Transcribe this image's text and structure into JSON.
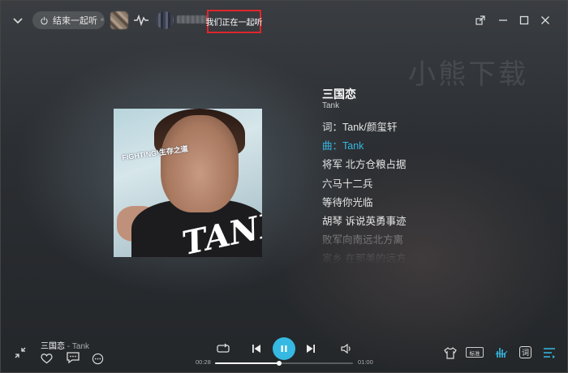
{
  "topbar": {
    "end_together_label": "结束一起听",
    "together_label": "我们正在一起听"
  },
  "watermark": "小熊下载",
  "album": {
    "cover_text": "FIGHTING!生存之道",
    "logo_text": "TANK"
  },
  "song": {
    "title": "三国恋",
    "artist": "Tank"
  },
  "lyrics": [
    {
      "pre": "词：",
      "text": "Tank/颜玺轩",
      "state": "normal"
    },
    {
      "pre": "曲：",
      "text": "Tank",
      "state": "highlight"
    },
    {
      "pre": "",
      "text": "将军 北方仓粮占据",
      "state": "normal"
    },
    {
      "pre": "",
      "text": "六马十二兵",
      "state": "normal"
    },
    {
      "pre": "",
      "text": "等待你光临",
      "state": "normal"
    },
    {
      "pre": "",
      "text": "胡琴 诉说英勇事迹",
      "state": "normal"
    },
    {
      "pre": "",
      "text": "败军向南远北方离",
      "state": "dim"
    },
    {
      "pre": "",
      "text": "家乡 在那美的远方",
      "state": "dim"
    }
  ],
  "now_playing": {
    "title": "三国恋",
    "separator": "-",
    "artist": "Tank"
  },
  "player": {
    "current_time": "00:28",
    "total_time": "01:00",
    "progress": 0.4667
  },
  "right_controls": {
    "quality_label": "标准",
    "lyric_label": "词"
  },
  "colors": {
    "accent": "#35b9e3",
    "highlight_border": "#e0262b"
  },
  "icons": {
    "collapse": "chevron-down-icon",
    "power": "power-icon",
    "pulse": "pulse-icon",
    "share": "share-icon",
    "minimize": "minimize-icon",
    "maximize": "maximize-icon",
    "close": "close-icon",
    "expand": "expand-icon",
    "like": "heart-icon",
    "comment": "comment-icon",
    "more": "more-icon",
    "loop": "loop-icon",
    "prev": "previous-icon",
    "pause": "pause-icon",
    "next": "next-icon",
    "volume": "volume-icon",
    "skin": "tshirt-icon",
    "effect": "sound-effect-icon",
    "playlist": "playlist-icon"
  }
}
